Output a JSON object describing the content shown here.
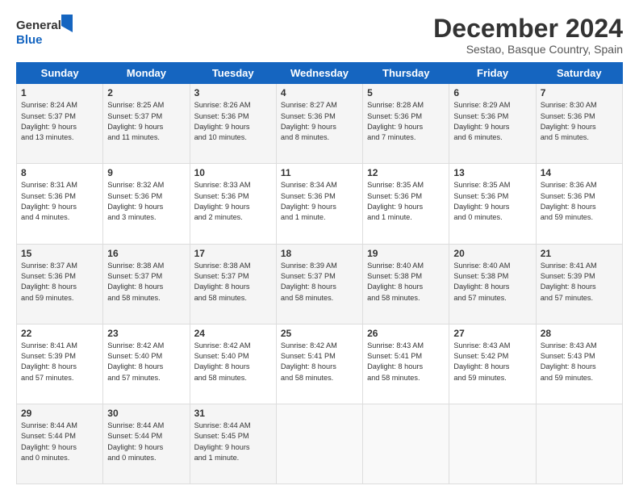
{
  "header": {
    "logo_line1": "General",
    "logo_line2": "Blue",
    "month_title": "December 2024",
    "subtitle": "Sestao, Basque Country, Spain"
  },
  "weekdays": [
    "Sunday",
    "Monday",
    "Tuesday",
    "Wednesday",
    "Thursday",
    "Friday",
    "Saturday"
  ],
  "weeks": [
    [
      {
        "day": "1",
        "text": "Sunrise: 8:24 AM\nSunset: 5:37 PM\nDaylight: 9 hours\nand 13 minutes."
      },
      {
        "day": "2",
        "text": "Sunrise: 8:25 AM\nSunset: 5:37 PM\nDaylight: 9 hours\nand 11 minutes."
      },
      {
        "day": "3",
        "text": "Sunrise: 8:26 AM\nSunset: 5:36 PM\nDaylight: 9 hours\nand 10 minutes."
      },
      {
        "day": "4",
        "text": "Sunrise: 8:27 AM\nSunset: 5:36 PM\nDaylight: 9 hours\nand 8 minutes."
      },
      {
        "day": "5",
        "text": "Sunrise: 8:28 AM\nSunset: 5:36 PM\nDaylight: 9 hours\nand 7 minutes."
      },
      {
        "day": "6",
        "text": "Sunrise: 8:29 AM\nSunset: 5:36 PM\nDaylight: 9 hours\nand 6 minutes."
      },
      {
        "day": "7",
        "text": "Sunrise: 8:30 AM\nSunset: 5:36 PM\nDaylight: 9 hours\nand 5 minutes."
      }
    ],
    [
      {
        "day": "8",
        "text": "Sunrise: 8:31 AM\nSunset: 5:36 PM\nDaylight: 9 hours\nand 4 minutes."
      },
      {
        "day": "9",
        "text": "Sunrise: 8:32 AM\nSunset: 5:36 PM\nDaylight: 9 hours\nand 3 minutes."
      },
      {
        "day": "10",
        "text": "Sunrise: 8:33 AM\nSunset: 5:36 PM\nDaylight: 9 hours\nand 2 minutes."
      },
      {
        "day": "11",
        "text": "Sunrise: 8:34 AM\nSunset: 5:36 PM\nDaylight: 9 hours\nand 1 minute."
      },
      {
        "day": "12",
        "text": "Sunrise: 8:35 AM\nSunset: 5:36 PM\nDaylight: 9 hours\nand 1 minute."
      },
      {
        "day": "13",
        "text": "Sunrise: 8:35 AM\nSunset: 5:36 PM\nDaylight: 9 hours\nand 0 minutes."
      },
      {
        "day": "14",
        "text": "Sunrise: 8:36 AM\nSunset: 5:36 PM\nDaylight: 8 hours\nand 59 minutes."
      }
    ],
    [
      {
        "day": "15",
        "text": "Sunrise: 8:37 AM\nSunset: 5:36 PM\nDaylight: 8 hours\nand 59 minutes."
      },
      {
        "day": "16",
        "text": "Sunrise: 8:38 AM\nSunset: 5:37 PM\nDaylight: 8 hours\nand 58 minutes."
      },
      {
        "day": "17",
        "text": "Sunrise: 8:38 AM\nSunset: 5:37 PM\nDaylight: 8 hours\nand 58 minutes."
      },
      {
        "day": "18",
        "text": "Sunrise: 8:39 AM\nSunset: 5:37 PM\nDaylight: 8 hours\nand 58 minutes."
      },
      {
        "day": "19",
        "text": "Sunrise: 8:40 AM\nSunset: 5:38 PM\nDaylight: 8 hours\nand 58 minutes."
      },
      {
        "day": "20",
        "text": "Sunrise: 8:40 AM\nSunset: 5:38 PM\nDaylight: 8 hours\nand 57 minutes."
      },
      {
        "day": "21",
        "text": "Sunrise: 8:41 AM\nSunset: 5:39 PM\nDaylight: 8 hours\nand 57 minutes."
      }
    ],
    [
      {
        "day": "22",
        "text": "Sunrise: 8:41 AM\nSunset: 5:39 PM\nDaylight: 8 hours\nand 57 minutes."
      },
      {
        "day": "23",
        "text": "Sunrise: 8:42 AM\nSunset: 5:40 PM\nDaylight: 8 hours\nand 57 minutes."
      },
      {
        "day": "24",
        "text": "Sunrise: 8:42 AM\nSunset: 5:40 PM\nDaylight: 8 hours\nand 58 minutes."
      },
      {
        "day": "25",
        "text": "Sunrise: 8:42 AM\nSunset: 5:41 PM\nDaylight: 8 hours\nand 58 minutes."
      },
      {
        "day": "26",
        "text": "Sunrise: 8:43 AM\nSunset: 5:41 PM\nDaylight: 8 hours\nand 58 minutes."
      },
      {
        "day": "27",
        "text": "Sunrise: 8:43 AM\nSunset: 5:42 PM\nDaylight: 8 hours\nand 59 minutes."
      },
      {
        "day": "28",
        "text": "Sunrise: 8:43 AM\nSunset: 5:43 PM\nDaylight: 8 hours\nand 59 minutes."
      }
    ],
    [
      {
        "day": "29",
        "text": "Sunrise: 8:44 AM\nSunset: 5:44 PM\nDaylight: 9 hours\nand 0 minutes."
      },
      {
        "day": "30",
        "text": "Sunrise: 8:44 AM\nSunset: 5:44 PM\nDaylight: 9 hours\nand 0 minutes."
      },
      {
        "day": "31",
        "text": "Sunrise: 8:44 AM\nSunset: 5:45 PM\nDaylight: 9 hours\nand 1 minute."
      },
      {
        "day": "",
        "text": ""
      },
      {
        "day": "",
        "text": ""
      },
      {
        "day": "",
        "text": ""
      },
      {
        "day": "",
        "text": ""
      }
    ]
  ]
}
